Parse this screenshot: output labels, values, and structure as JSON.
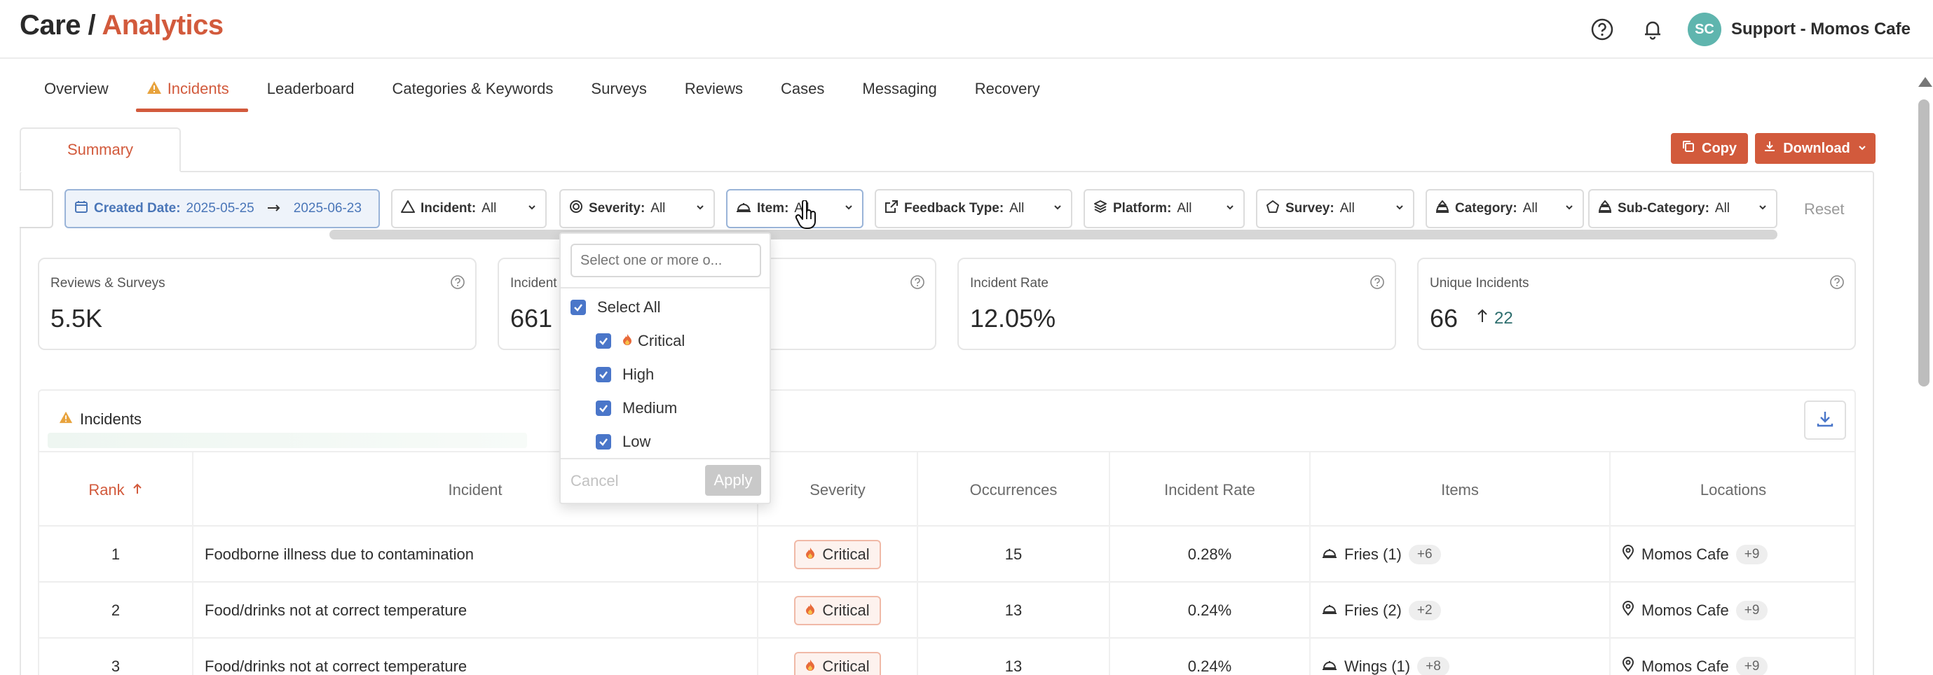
{
  "header": {
    "title_prefix": "Care /",
    "title_accent": "Analytics",
    "user_initials": "SC",
    "user_name": "Support - Momos Cafe"
  },
  "tabs": [
    {
      "label": "Overview"
    },
    {
      "label": "Incidents",
      "active": true,
      "icon": "warning-icon"
    },
    {
      "label": "Leaderboard"
    },
    {
      "label": "Categories & Keywords"
    },
    {
      "label": "Surveys"
    },
    {
      "label": "Reviews"
    },
    {
      "label": "Cases"
    },
    {
      "label": "Messaging"
    },
    {
      "label": "Recovery"
    }
  ],
  "summary_tab": "Summary",
  "actions": {
    "copy": "Copy",
    "download": "Download"
  },
  "filters": {
    "created_date": {
      "label": "Created Date:",
      "from": "2025-05-25",
      "to": "2025-06-23"
    },
    "incident": {
      "label": "Incident:",
      "value": "All"
    },
    "severity": {
      "label": "Severity:",
      "value": "All"
    },
    "item": {
      "label": "Item:",
      "value": "All"
    },
    "feedback_type": {
      "label": "Feedback Type:",
      "value": "All"
    },
    "platform": {
      "label": "Platform:",
      "value": "All"
    },
    "survey": {
      "label": "Survey:",
      "value": "All"
    },
    "category": {
      "label": "Category:",
      "value": "All"
    },
    "sub_category": {
      "label": "Sub-Category:",
      "value": "All"
    },
    "reset": "Reset"
  },
  "metrics": {
    "reviews_surveys": {
      "label": "Reviews & Surveys",
      "value": "5.5K"
    },
    "incidents": {
      "label": "Incident",
      "value": "661"
    },
    "incident_rate": {
      "label": "Incident Rate",
      "value": "12.05%"
    },
    "unique_incidents": {
      "label": "Unique Incidents",
      "value": "66",
      "delta": "22"
    }
  },
  "dropdown": {
    "placeholder": "Select one or more o...",
    "select_all": "Select All",
    "options": [
      "Critical",
      "High",
      "Medium",
      "Low"
    ],
    "cancel": "Cancel",
    "apply": "Apply"
  },
  "table": {
    "title": "Incidents",
    "columns": {
      "rank": "Rank",
      "incident": "Incident",
      "severity": "Severity",
      "occurrences": "Occurrences",
      "rate": "Incident Rate",
      "items": "Items",
      "locations": "Locations"
    },
    "rows": [
      {
        "rank": "1",
        "incident": "Foodborne illness due to contamination",
        "severity": "Critical",
        "occurrences": "15",
        "rate": "0.28%",
        "item": "Fries (1)",
        "item_more": "+6",
        "location": "Momos Cafe",
        "location_more": "+9"
      },
      {
        "rank": "2",
        "incident": "Food/drinks not at correct temperature",
        "severity": "Critical",
        "occurrences": "13",
        "rate": "0.24%",
        "item": "Fries (2)",
        "item_more": "+2",
        "location": "Momos Cafe",
        "location_more": "+9"
      },
      {
        "rank": "3",
        "incident": "Food/drinks not at correct temperature",
        "severity": "Critical",
        "occurrences": "13",
        "rate": "0.24%",
        "item": "Wings (1)",
        "item_more": "+8",
        "location": "Momos Cafe",
        "location_more": "+9"
      }
    ]
  },
  "colors": {
    "accent": "#d25a3c",
    "checkbox": "#4a76c9",
    "avatar": "#5fb5ae"
  }
}
